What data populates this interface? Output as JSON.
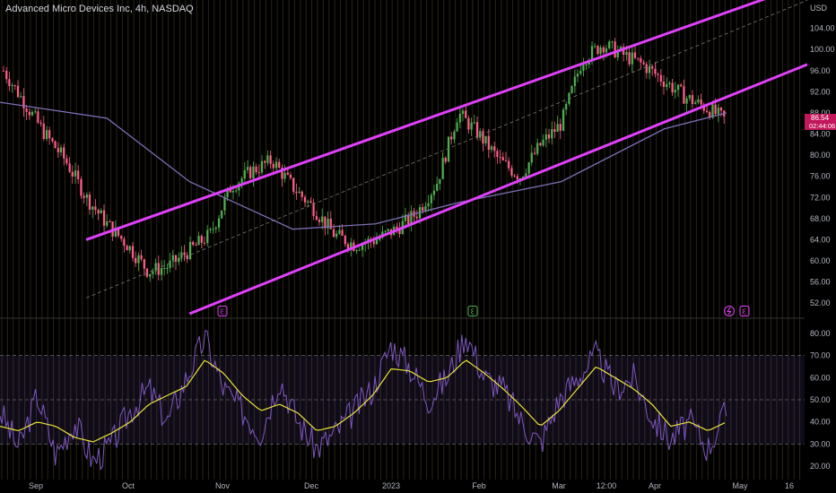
{
  "header": {
    "title": "Advanced Micro Devices Inc, 4h, NASDAQ"
  },
  "price_axis": {
    "currency": "USD"
  },
  "last_price": {
    "value": "86.54",
    "countdown": "02:44:06"
  },
  "colors": {
    "channel": "#e040fb",
    "ma": "#7e6fb8",
    "candle_up": "#4caf50",
    "candle_down": "#ff5b8a",
    "rsi": "#7e57c2",
    "rsi_ma": "#e8e336",
    "tag": "#c2185b"
  },
  "event_icons": [
    "earnings-icon",
    "earnings-icon",
    "dividend-icon",
    "earnings-icon"
  ],
  "chart_data": [
    {
      "type": "candlestick",
      "title": "Advanced Micro Devices Inc, 4h, NASDAQ",
      "x_ticks": [
        "Sep",
        "Oct",
        "Nov",
        "Dec",
        "2023",
        "Feb",
        "Mar",
        "12:00",
        "Apr",
        "May",
        "16"
      ],
      "y_ticks": [
        52.0,
        56.0,
        60.0,
        64.0,
        68.0,
        72.0,
        76.0,
        80.0,
        84.0,
        88.0,
        92.0,
        96.0,
        100.0,
        104.0
      ],
      "ylim": [
        50,
        108
      ],
      "price_path": {
        "x": [
          "Sep",
          "Sep+",
          "Sep++",
          "late Sep",
          "Oct-",
          "Oct",
          "Oct+",
          "mid Oct",
          "late Oct",
          "Nov",
          "Nov+",
          "Nov mid",
          "late Nov",
          "Dec-",
          "Dec",
          "Dec+",
          "mid Dec",
          "late Dec",
          "2023",
          "Jan+",
          "mid Jan",
          "late Jan",
          "Feb",
          "Feb+",
          "mid Feb",
          "late Feb",
          "Mar-",
          "Mar",
          "Mar+",
          "12:00",
          "late Mar",
          "Apr-",
          "Apr",
          "Apr+",
          "mid Apr",
          "late Apr"
        ],
        "close": [
          96,
          90,
          84,
          79,
          72,
          67,
          63,
          58,
          59,
          62,
          65,
          74,
          77,
          79,
          74,
          70,
          65,
          63,
          64,
          66,
          69,
          75,
          88,
          84,
          79,
          76,
          82,
          86,
          98,
          101,
          99,
          97,
          94,
          91,
          89,
          86.54
        ]
      },
      "series": [
        {
          "name": "moving average",
          "x": [
            "Sep",
            "Oct",
            "Nov",
            "Dec",
            "2023",
            "Feb",
            "Mar",
            "Apr",
            "late Apr"
          ],
          "values": [
            90,
            87,
            75,
            66,
            67,
            71,
            75,
            85,
            88
          ]
        }
      ],
      "annotations": [
        {
          "type": "trend line",
          "from": [
            "Oct-",
            64
          ],
          "to": [
            "late Apr",
            107
          ]
        },
        {
          "type": "trend line",
          "from": [
            "Nov",
            50
          ],
          "to": [
            "late Apr",
            91
          ]
        },
        {
          "type": "dashed trend line",
          "from": [
            "Oct-",
            53
          ],
          "to": [
            "late Apr",
            103
          ]
        }
      ],
      "last_price": 86.54
    },
    {
      "type": "line",
      "y_ticks": [
        20.0,
        30.0,
        40.0,
        50.0,
        60.0,
        70.0,
        80.0
      ],
      "ylim": [
        16,
        84
      ],
      "bands": [
        30,
        50,
        70
      ],
      "series": [
        {
          "values": [
            45,
            28,
            52,
            25,
            40,
            22,
            30,
            45,
            55,
            40,
            60,
            78,
            55,
            45,
            35,
            60,
            40,
            28,
            35,
            45,
            55,
            75,
            65,
            50,
            60,
            80,
            60,
            55,
            40,
            30,
            50,
            60,
            70,
            55,
            60,
            42,
            32,
            40,
            28,
            45
          ]
        },
        {
          "values": [
            38,
            36,
            40,
            38,
            33,
            31,
            35,
            40,
            48,
            52,
            56,
            68,
            62,
            52,
            45,
            48,
            44,
            36,
            38,
            44,
            52,
            64,
            63,
            58,
            60,
            68,
            62,
            55,
            47,
            38,
            45,
            55,
            65,
            60,
            55,
            48,
            38,
            40,
            36,
            40
          ]
        }
      ]
    }
  ]
}
